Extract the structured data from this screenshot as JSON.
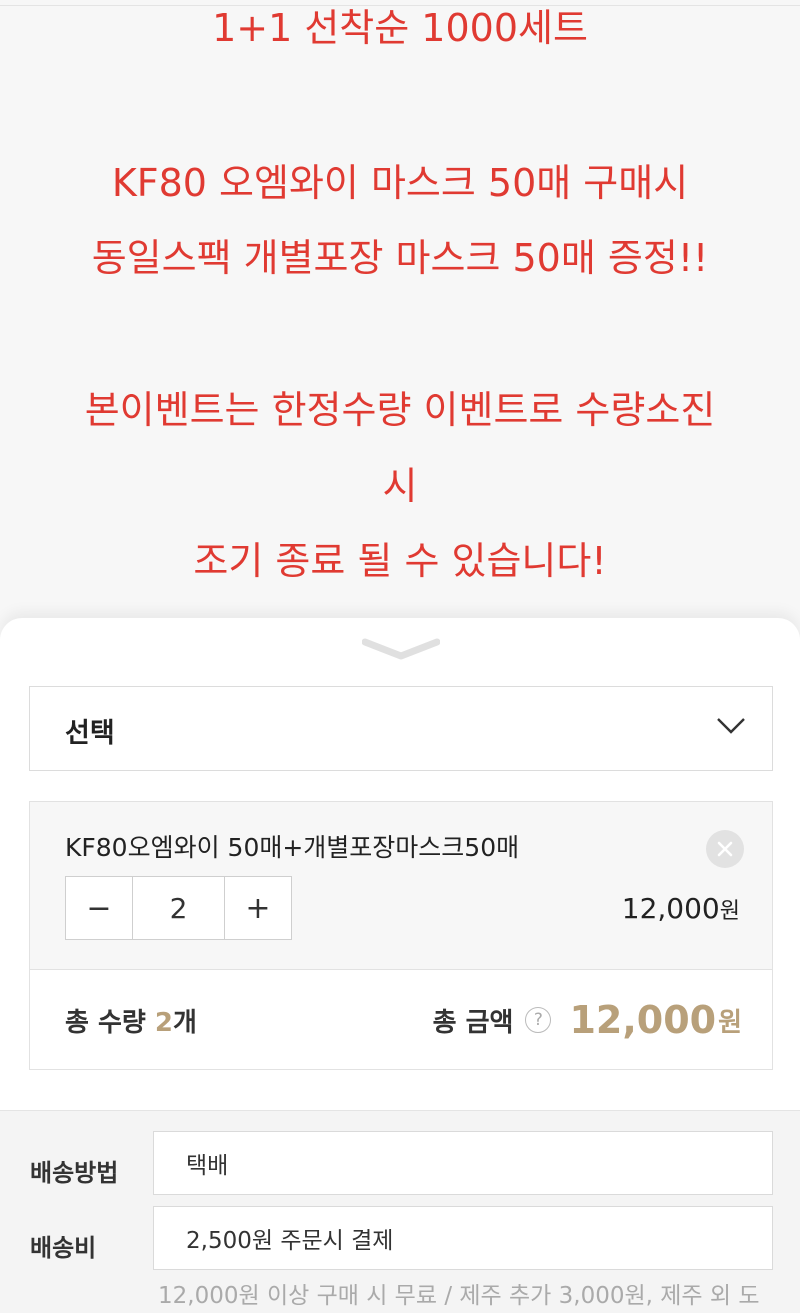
{
  "promo": {
    "line1": "1+1 선착순 1000세트",
    "line2": "KF80 오엠와이 마스크 50매 구매시",
    "line3": "동일스팩 개별포장 마스크 50매 증정!!",
    "line4": "본이벤트는 한정수량 이벤트로 수량소진",
    "line5": "시",
    "line6": "조기 종료 될 수 있습니다!"
  },
  "option_select": {
    "label": "선택"
  },
  "selected_item": {
    "name": "KF80오엠와이 50매+개별포장마스크50매",
    "minus": "−",
    "quantity": "2",
    "plus": "+",
    "price": "12,000",
    "price_unit": "원"
  },
  "summary": {
    "qty_label": "총 수량 ",
    "qty_value": "2",
    "qty_unit": "개",
    "amount_label": "총 금액",
    "help_icon": "?",
    "amount_value": "12,000",
    "amount_unit": "원"
  },
  "shipping": {
    "method_label": "배송방법",
    "method_value": "택배",
    "fee_label": "배송비",
    "fee_value": "2,500원 주문시 결제",
    "note": "12,000원 이상 구매 시 무료 / 제주 추가 3,000원, 제주 외 도"
  },
  "colors": {
    "promo_text": "#e03a32",
    "accent_gold": "#b8a07a"
  }
}
